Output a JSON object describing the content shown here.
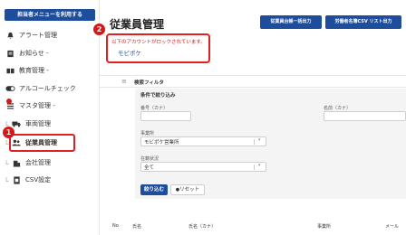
{
  "sidebar": {
    "admin_button": "担当者メニューを利用する",
    "items": [
      {
        "label": "アラート管理",
        "icon": "bell-icon"
      },
      {
        "label": "お知らせ -",
        "icon": "document-icon"
      },
      {
        "label": "教育管理 -",
        "icon": "book-icon"
      },
      {
        "label": "アルコールチェック",
        "icon": "toggle-icon"
      },
      {
        "label": "マスタ管理 -",
        "icon": "list-icon"
      },
      {
        "label": "車両管理",
        "icon": "truck-icon"
      },
      {
        "label": "従業員管理",
        "icon": "users-icon"
      },
      {
        "label": "会社管理",
        "icon": "building-icon"
      },
      {
        "label": "CSV設定",
        "icon": "csv-file-icon"
      }
    ],
    "tick": "L"
  },
  "annotations": {
    "step1": "1",
    "step2": "2"
  },
  "main": {
    "title": "従業員管理",
    "buttons": {
      "bulk_output": "従業員台帳一括出力",
      "csv_output": "労働者名簿CSV リスト出力"
    },
    "alert": {
      "message": "以下のアカウントがロックされています。",
      "link": "モビポケ"
    },
    "filter": {
      "menu_icon": "≡",
      "header": "検索フィルタ",
      "panel_title": "条件で絞り込み",
      "employee_no_label": "番号（カナ）",
      "name_label": "名前（カナ）",
      "office_label": "事業所",
      "office_value": "モビポケ営業所",
      "status_label": "在籍状況",
      "status_value": "全て",
      "search_button": "絞り込む",
      "reset_button": "リセット",
      "reset_icon": "●"
    },
    "table_headers": [
      "No",
      "氏名",
      "氏名（カナ）",
      "事業所",
      "メール"
    ]
  },
  "colors": {
    "primary": "#1e4d9b",
    "alert_red": "#e02020"
  }
}
